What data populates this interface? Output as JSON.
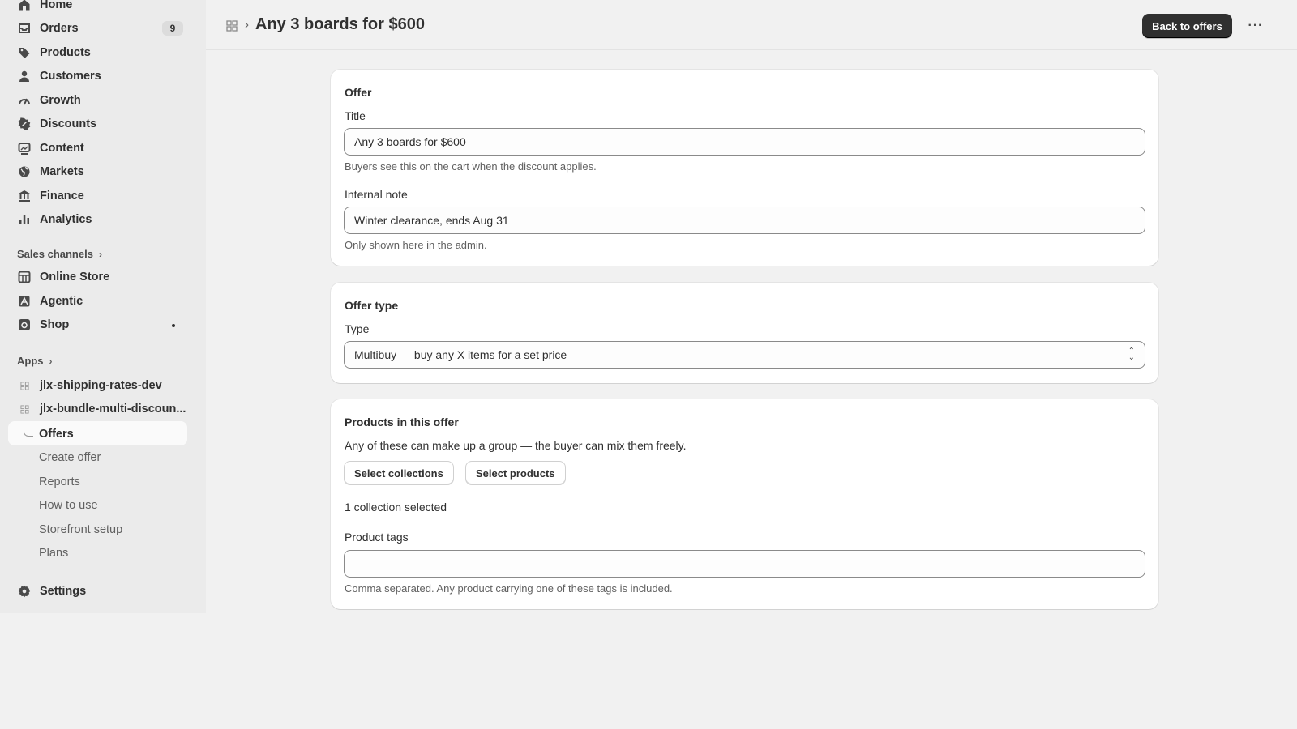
{
  "sidebar": {
    "nav": [
      {
        "label": "Home",
        "icon": "home-icon"
      },
      {
        "label": "Orders",
        "icon": "orders-icon",
        "badge": "9"
      },
      {
        "label": "Products",
        "icon": "tag-icon"
      },
      {
        "label": "Customers",
        "icon": "person-icon"
      },
      {
        "label": "Growth",
        "icon": "gauge-icon"
      },
      {
        "label": "Discounts",
        "icon": "discount-icon"
      },
      {
        "label": "Content",
        "icon": "content-icon"
      },
      {
        "label": "Markets",
        "icon": "globe-icon"
      },
      {
        "label": "Finance",
        "icon": "bank-icon"
      },
      {
        "label": "Analytics",
        "icon": "bar-chart-icon"
      }
    ],
    "sales_channels_label": "Sales channels",
    "channels": [
      {
        "label": "Online Store",
        "icon": "store-icon"
      },
      {
        "label": "Agentic",
        "icon": "agentic-icon"
      },
      {
        "label": "Shop",
        "icon": "shop-icon"
      }
    ],
    "apps_label": "Apps",
    "apps": [
      {
        "label": "jlx-shipping-rates-dev"
      },
      {
        "label": "jlx-bundle-multi-discoun..."
      }
    ],
    "app_subitems": [
      "Offers",
      "Create offer",
      "Reports",
      "How to use",
      "Storefront setup",
      "Plans"
    ],
    "settings_label": "Settings"
  },
  "header": {
    "title": "Any 3 boards for $600",
    "back_button": "Back to offers"
  },
  "offer_card": {
    "title": "Offer",
    "title_label": "Title",
    "title_value": "Any 3 boards for $600",
    "title_help": "Buyers see this on the cart when the discount applies.",
    "note_label": "Internal note",
    "note_value": "Winter clearance, ends Aug 31",
    "note_help": "Only shown here in the admin."
  },
  "type_card": {
    "title": "Offer type",
    "type_label": "Type",
    "type_value": "Multibuy — buy any X items for a set price"
  },
  "products_card": {
    "title": "Products in this offer",
    "description": "Any of these can make up a group — the buyer can mix them freely.",
    "select_collections": "Select collections",
    "select_products": "Select products",
    "selected_summary": "1 collection selected",
    "tags_label": "Product tags",
    "tags_value": "",
    "tags_help": "Comma separated. Any product carrying one of these tags is included."
  },
  "colors": {
    "primary_button": "#303030",
    "sidebar_bg": "#ebebeb",
    "page_bg": "#f1f1f1"
  }
}
